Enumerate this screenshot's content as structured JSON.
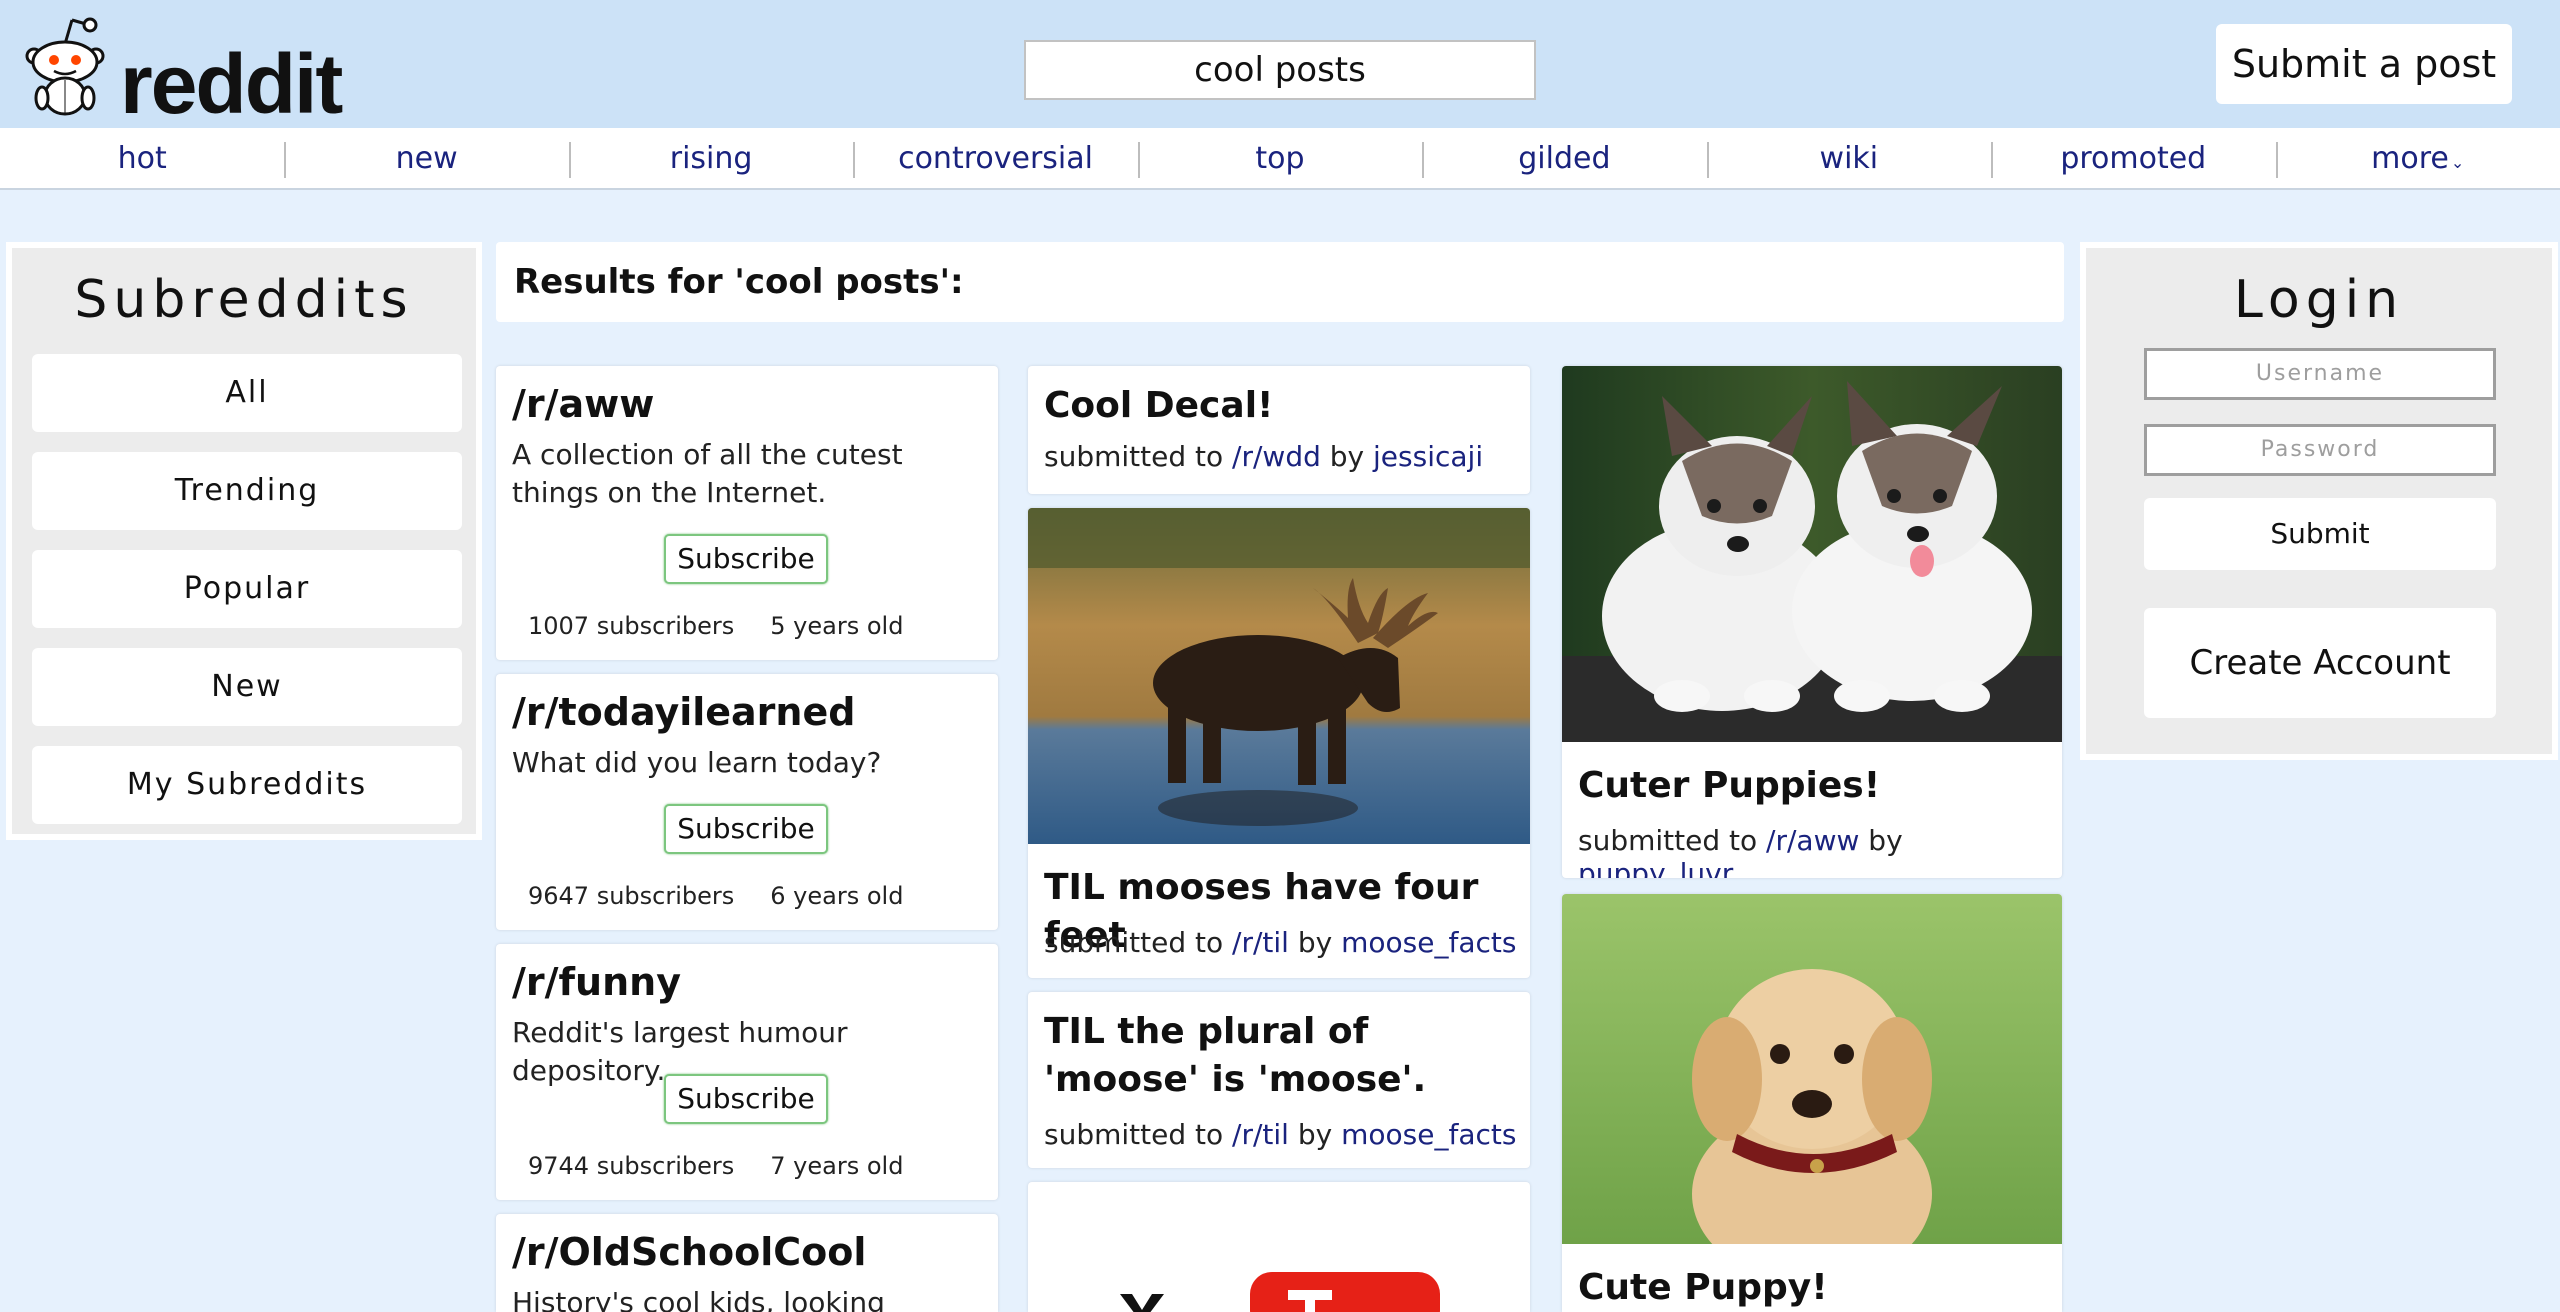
{
  "header": {
    "logo_text": "reddit",
    "search_value": "cool posts",
    "submit_post_label": "Submit a post"
  },
  "nav": {
    "items": [
      "hot",
      "new",
      "rising",
      "controversial",
      "top",
      "gilded",
      "wiki",
      "promoted",
      "more"
    ]
  },
  "subreddits_panel": {
    "title": "Subreddits",
    "items": [
      "All",
      "Trending",
      "Popular",
      "New",
      "My Subreddits"
    ]
  },
  "login_panel": {
    "title": "Login",
    "username_placeholder": "Username",
    "password_placeholder": "Password",
    "submit_label": "Submit",
    "create_account_label": "Create Account"
  },
  "results": {
    "heading": "Results for 'cool posts':"
  },
  "subreddit_results": [
    {
      "name": "/r/aww",
      "description": "A collection of all the cutest things on the Internet.",
      "subscribe_label": "Subscribe",
      "subscribers": "1007 subscribers",
      "age": "5 years old"
    },
    {
      "name": "/r/todayilearned",
      "description": "What did you learn today?",
      "subscribe_label": "Subscribe",
      "subscribers": "9647 subscribers",
      "age": "6 years old"
    },
    {
      "name": "/r/funny",
      "description": "Reddit's largest humour depository.",
      "subscribe_label": "Subscribe",
      "subscribers": "9744 subscribers",
      "age": "7 years old"
    },
    {
      "name": "/r/OldSchoolCool",
      "description": "History's cool kids, looking fantastic!"
    }
  ],
  "posts": [
    {
      "title": "Cool Decal!",
      "submitted_to": "submitted to",
      "subreddit": "/r/wdd",
      "by": "by",
      "author": "jessicaji"
    },
    {
      "title": "TIL mooses have four feet",
      "submitted_to": "submitted to",
      "subreddit": "/r/til",
      "by": "by",
      "author": "moose_facts"
    },
    {
      "title": "TIL the plural of 'moose' is 'moose'.",
      "submitted_to": "submitted to",
      "subreddit": "/r/til",
      "by": "by",
      "author": "moose_facts"
    },
    {
      "title": "Cuter Puppies!",
      "submitted_to": "submitted to",
      "subreddit": "/r/aww",
      "by": "by",
      "author": "puppy_luvr"
    },
    {
      "title": "Cute Puppy!"
    }
  ],
  "colors": {
    "header_bg": "#cce2f7",
    "page_bg": "#e6f1fd",
    "link": "#1a237e",
    "subscribe_border": "#7cc67f",
    "youtube_red": "#e62117"
  },
  "icons": {
    "logo": "reddit-alien-icon",
    "more_caret": "chevron-down-icon",
    "video_logo": "youtube-logo"
  }
}
